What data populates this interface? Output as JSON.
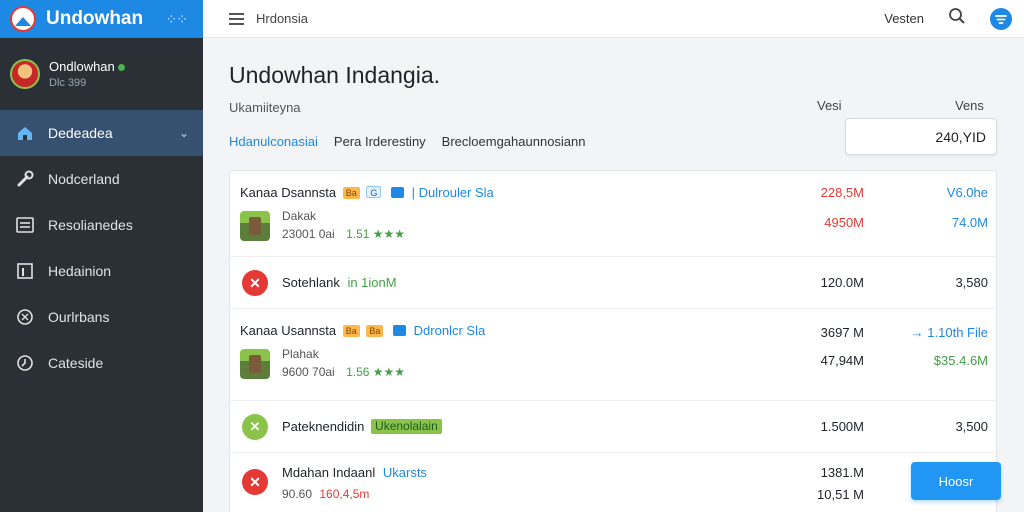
{
  "brand": {
    "name": "Undowhan"
  },
  "profile": {
    "name": "Ondlowhan",
    "sub": "Dlc 399"
  },
  "nav": [
    {
      "label": "Dedeadea",
      "icon": "home-icon",
      "active": true
    },
    {
      "label": "Nodcerland",
      "icon": "tools-icon"
    },
    {
      "label": "Resolianedes",
      "icon": "list-icon"
    },
    {
      "label": "Hedainion",
      "icon": "chart-icon"
    },
    {
      "label": "Ourlrbans",
      "icon": "settings-icon"
    },
    {
      "label": "Cateside",
      "icon": "clock-icon"
    }
  ],
  "topbar": {
    "title": "Hrdonsia",
    "version": "Vesten"
  },
  "main": {
    "title": "Undowhan Indangia.",
    "subtitle": "Ukamiiteyna",
    "col_ver": "Vesi",
    "col_vers": "Vens",
    "tabs": [
      "Hdanulconasiai",
      "Pera Irderestiny",
      "Brecloemgahaunnosiann"
    ],
    "size_value": "240,YID"
  },
  "rows": [
    {
      "title": "Kanaa Dsannsta",
      "badge1": "Ba",
      "badge2": "G",
      "link": "| Dulrouler Sla",
      "line2": "Dakak",
      "line3a": "23001 0ai",
      "line3b": "1.51 ★★★",
      "size1": "228,5M",
      "size2": "4950M",
      "ver1": "V6.0he",
      "ver2": "74.0M"
    },
    {
      "title": "Sotehlank",
      "tag": "in 1ionM",
      "size": "120.0M",
      "ver": "3,580"
    },
    {
      "title": "Kanaa Usannsta",
      "badge1": "Ba",
      "badge2": "Ba",
      "link": "Ddronlcr Sla",
      "line2": "Plahak",
      "line3a": "9600 70ai",
      "line3b": "1.56 ★★★",
      "size1": "3697 M",
      "size2": "47,94M",
      "ver1": "→ 1.10th File",
      "ver2": "$35.4.6M"
    },
    {
      "title": "Pateknendidin",
      "tag": "Ukenolalain",
      "size": "1.500M",
      "ver": "3,500"
    },
    {
      "title": "Mdahan Indaanl",
      "link": "Ukarsts",
      "line2a": "90.60",
      "line2b": "160,4,5m",
      "size1": "1381.M",
      "size2": "10,51 M"
    }
  ],
  "download_button": "Hoosr",
  "colors": {
    "accent": "#1e88e5",
    "sidebar": "#2b3036",
    "danger": "#e53935",
    "success": "#43a047"
  }
}
